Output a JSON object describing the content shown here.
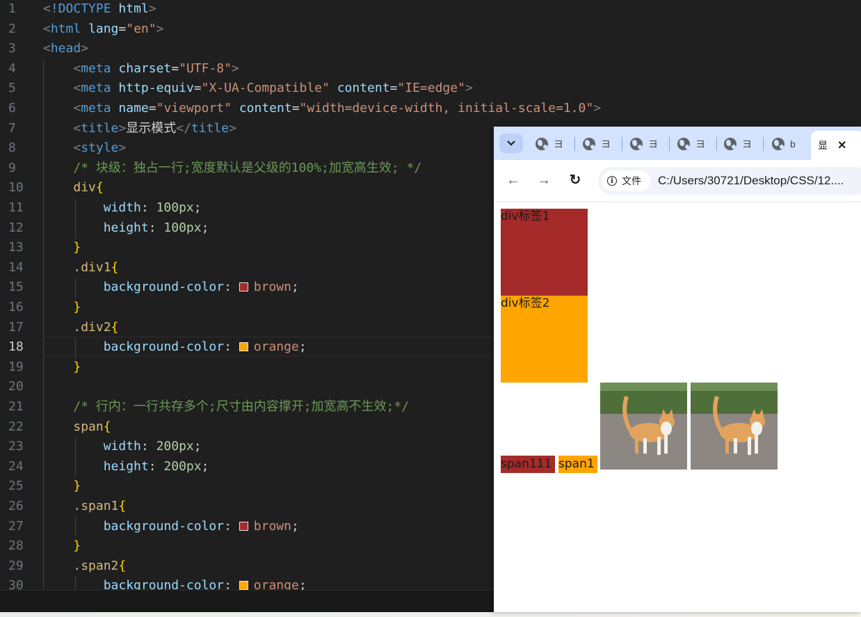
{
  "editor": {
    "active_line": 18,
    "lines": [
      {
        "n": "1"
      },
      {
        "n": "2"
      },
      {
        "n": "3"
      },
      {
        "n": "4"
      },
      {
        "n": "5"
      },
      {
        "n": "6"
      },
      {
        "n": "7"
      },
      {
        "n": "8"
      },
      {
        "n": "9"
      },
      {
        "n": "10"
      },
      {
        "n": "11"
      },
      {
        "n": "12"
      },
      {
        "n": "13"
      },
      {
        "n": "14"
      },
      {
        "n": "15"
      },
      {
        "n": "16"
      },
      {
        "n": "17"
      },
      {
        "n": "18"
      },
      {
        "n": "19"
      },
      {
        "n": "20"
      },
      {
        "n": "21"
      },
      {
        "n": "22"
      },
      {
        "n": "23"
      },
      {
        "n": "24"
      },
      {
        "n": "25"
      },
      {
        "n": "26"
      },
      {
        "n": "27"
      },
      {
        "n": "28"
      },
      {
        "n": "29"
      },
      {
        "n": "30"
      }
    ],
    "tokens": [
      [
        [
          "t-punc",
          "<"
        ],
        [
          "t-tag",
          "!DOCTYPE"
        ],
        [
          "t-text",
          " "
        ],
        [
          "t-attr",
          "html"
        ],
        [
          "t-punc",
          ">"
        ]
      ],
      [
        [
          "t-punc",
          "<"
        ],
        [
          "t-tag",
          "html"
        ],
        [
          "t-text",
          " "
        ],
        [
          "t-attr",
          "lang"
        ],
        [
          "t-text",
          "="
        ],
        [
          "t-str",
          "\"en\""
        ],
        [
          "t-punc",
          ">"
        ]
      ],
      [
        [
          "t-punc",
          "<"
        ],
        [
          "t-tag",
          "head"
        ],
        [
          "t-punc",
          ">"
        ]
      ],
      [
        [
          "t-text",
          "    "
        ],
        [
          "t-punc",
          "<"
        ],
        [
          "t-tag",
          "meta"
        ],
        [
          "t-text",
          " "
        ],
        [
          "t-attr",
          "charset"
        ],
        [
          "t-text",
          "="
        ],
        [
          "t-str",
          "\"UTF-8\""
        ],
        [
          "t-punc",
          ">"
        ]
      ],
      [
        [
          "t-text",
          "    "
        ],
        [
          "t-punc",
          "<"
        ],
        [
          "t-tag",
          "meta"
        ],
        [
          "t-text",
          " "
        ],
        [
          "t-attr",
          "http-equiv"
        ],
        [
          "t-text",
          "="
        ],
        [
          "t-str",
          "\"X-UA-Compatible\""
        ],
        [
          "t-text",
          " "
        ],
        [
          "t-attr",
          "content"
        ],
        [
          "t-text",
          "="
        ],
        [
          "t-str",
          "\"IE=edge\""
        ],
        [
          "t-punc",
          ">"
        ]
      ],
      [
        [
          "t-text",
          "    "
        ],
        [
          "t-punc",
          "<"
        ],
        [
          "t-tag",
          "meta"
        ],
        [
          "t-text",
          " "
        ],
        [
          "t-attr",
          "name"
        ],
        [
          "t-text",
          "="
        ],
        [
          "t-str",
          "\"viewport\""
        ],
        [
          "t-text",
          " "
        ],
        [
          "t-attr",
          "content"
        ],
        [
          "t-text",
          "="
        ],
        [
          "t-str",
          "\"width=device-width, initial-scale=1.0\""
        ],
        [
          "t-punc",
          ">"
        ]
      ],
      [
        [
          "t-text",
          "    "
        ],
        [
          "t-punc",
          "<"
        ],
        [
          "t-tag",
          "title"
        ],
        [
          "t-punc",
          ">"
        ],
        [
          "t-text",
          "显示模式"
        ],
        [
          "t-punc",
          "</"
        ],
        [
          "t-tag",
          "title"
        ],
        [
          "t-punc",
          ">"
        ]
      ],
      [
        [
          "t-text",
          "    "
        ],
        [
          "t-punc",
          "<"
        ],
        [
          "t-tag",
          "style"
        ],
        [
          "t-punc",
          ">"
        ]
      ],
      [
        [
          "t-text",
          "    "
        ],
        [
          "t-com",
          "/* 块级：独占一行;宽度默认是父级的100%;加宽高生效; */"
        ]
      ],
      [
        [
          "t-text",
          "    "
        ],
        [
          "t-sel",
          "div"
        ],
        [
          "t-brace",
          "{"
        ]
      ],
      [
        [
          "t-text",
          "        "
        ],
        [
          "t-prop",
          "width"
        ],
        [
          "t-text",
          ": "
        ],
        [
          "t-num",
          "100px"
        ],
        [
          "t-text",
          ";"
        ]
      ],
      [
        [
          "t-text",
          "        "
        ],
        [
          "t-prop",
          "height"
        ],
        [
          "t-text",
          ": "
        ],
        [
          "t-num",
          "100px"
        ],
        [
          "t-text",
          ";"
        ]
      ],
      [
        [
          "t-text",
          "    "
        ],
        [
          "t-brace",
          "}"
        ]
      ],
      [
        [
          "t-text",
          "    "
        ],
        [
          "t-sel",
          ".div1"
        ],
        [
          "t-brace",
          "{"
        ]
      ],
      [
        [
          "t-text",
          "        "
        ],
        [
          "t-prop",
          "background-color"
        ],
        [
          "t-text",
          ": "
        ],
        [
          "swatch",
          "#a52a2a"
        ],
        [
          "t-val",
          "brown"
        ],
        [
          "t-text",
          ";"
        ]
      ],
      [
        [
          "t-text",
          "    "
        ],
        [
          "t-brace",
          "}"
        ]
      ],
      [
        [
          "t-text",
          "    "
        ],
        [
          "t-sel",
          ".div2"
        ],
        [
          "t-brace",
          "{"
        ]
      ],
      [
        [
          "t-text",
          "        "
        ],
        [
          "t-prop",
          "background-color"
        ],
        [
          "t-text",
          ": "
        ],
        [
          "swatch",
          "#ffa500"
        ],
        [
          "t-val",
          "orange"
        ],
        [
          "t-text",
          ";"
        ]
      ],
      [
        [
          "t-text",
          "    "
        ],
        [
          "t-brace",
          "}"
        ]
      ],
      [],
      [
        [
          "t-text",
          "    "
        ],
        [
          "t-com",
          "/* 行内：一行共存多个;尺寸由内容撑开;加宽高不生效;*/"
        ]
      ],
      [
        [
          "t-text",
          "    "
        ],
        [
          "t-sel",
          "span"
        ],
        [
          "t-brace",
          "{"
        ]
      ],
      [
        [
          "t-text",
          "        "
        ],
        [
          "t-prop",
          "width"
        ],
        [
          "t-text",
          ": "
        ],
        [
          "t-num",
          "200px"
        ],
        [
          "t-text",
          ";"
        ]
      ],
      [
        [
          "t-text",
          "        "
        ],
        [
          "t-prop",
          "height"
        ],
        [
          "t-text",
          ": "
        ],
        [
          "t-num",
          "200px"
        ],
        [
          "t-text",
          ";"
        ]
      ],
      [
        [
          "t-text",
          "    "
        ],
        [
          "t-brace",
          "}"
        ]
      ],
      [
        [
          "t-text",
          "    "
        ],
        [
          "t-sel",
          ".span1"
        ],
        [
          "t-brace",
          "{"
        ]
      ],
      [
        [
          "t-text",
          "        "
        ],
        [
          "t-prop",
          "background-color"
        ],
        [
          "t-text",
          ": "
        ],
        [
          "swatch",
          "#a52a2a"
        ],
        [
          "t-val",
          "brown"
        ],
        [
          "t-text",
          ";"
        ]
      ],
      [
        [
          "t-text",
          "    "
        ],
        [
          "t-brace",
          "}"
        ]
      ],
      [
        [
          "t-text",
          "    "
        ],
        [
          "t-sel",
          ".span2"
        ],
        [
          "t-brace",
          "{"
        ]
      ],
      [
        [
          "t-text",
          "        "
        ],
        [
          "t-prop",
          "background-color"
        ],
        [
          "t-text",
          ": "
        ],
        [
          "swatch",
          "#ffa500"
        ],
        [
          "t-val",
          "orange"
        ],
        [
          "t-text",
          ";"
        ]
      ]
    ]
  },
  "browser": {
    "tab_menu_icon": "chevron-down-icon",
    "tabs": [
      {
        "label": "ヨ",
        "icon": "globe-icon"
      },
      {
        "label": "ヨ",
        "icon": "globe-icon"
      },
      {
        "label": "ヨ",
        "icon": "globe-icon"
      },
      {
        "label": "ヨ",
        "icon": "globe-icon"
      },
      {
        "label": "ヨ",
        "icon": "globe-icon"
      },
      {
        "label": "b",
        "icon": "globe-icon"
      }
    ],
    "active_tab": {
      "label": "显",
      "close": "✕"
    },
    "nav": {
      "back": "←",
      "forward": "→",
      "reload": "↻"
    },
    "site_chip": {
      "icon_text": "i",
      "label": "文件"
    },
    "url": "C:/Users/30721/Desktop/CSS/12....",
    "page": {
      "div1": {
        "text": "div标签1",
        "color": "#a52a2a"
      },
      "div2": {
        "text": "div标签2",
        "color": "#ffa500"
      },
      "span1": {
        "text": "span111",
        "color": "#a52a2a"
      },
      "span2": {
        "text": "span1",
        "color": "#ffa500"
      },
      "images": [
        {
          "icon": "cat-photo"
        },
        {
          "icon": "cat-photo"
        }
      ]
    }
  },
  "colors": {
    "brown": "#a52a2a",
    "orange": "#ffa500"
  }
}
